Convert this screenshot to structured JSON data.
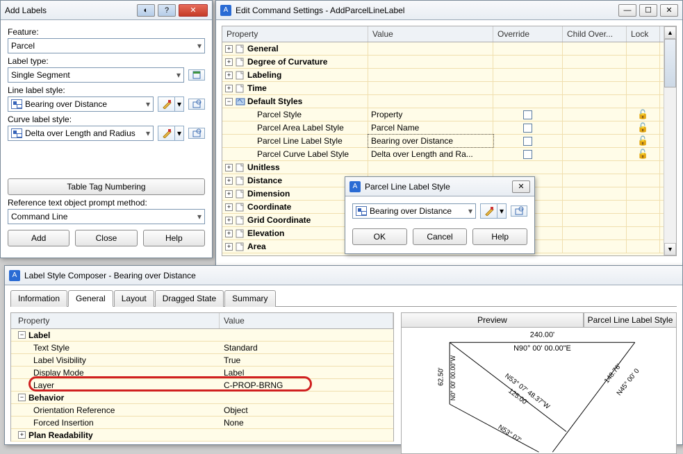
{
  "addLabels": {
    "title": "Add Labels",
    "feature_label": "Feature:",
    "feature_value": "Parcel",
    "labeltype_label": "Label type:",
    "labeltype_value": "Single Segment",
    "linelabel_label": "Line label style:",
    "linelabel_value": "Bearing over Distance",
    "curvelabel_label": "Curve label style:",
    "curvelabel_value": "Delta over Length and Radius",
    "tabletag_btn": "Table Tag Numbering",
    "refmethod_label": "Reference text object prompt method:",
    "refmethod_value": "Command Line",
    "add_btn": "Add",
    "close_btn": "Close",
    "help_btn": "Help"
  },
  "editCmd": {
    "title": "Edit Command Settings - AddParcelLineLabel",
    "headers": {
      "property": "Property",
      "value": "Value",
      "override": "Override",
      "childover": "Child Over...",
      "lock": "Lock"
    },
    "groups_top": [
      "General",
      "Degree of Curvature",
      "Labeling",
      "Time"
    ],
    "default_styles_label": "Default Styles",
    "default_styles": [
      {
        "name": "Parcel Style",
        "value": "Property"
      },
      {
        "name": "Parcel Area Label Style",
        "value": "Parcel Name"
      },
      {
        "name": "Parcel Line Label Style",
        "value": "Bearing over Distance",
        "sel_val": true
      },
      {
        "name": "Parcel Curve Label Style",
        "value": "Delta over Length and Ra..."
      }
    ],
    "groups_bot": [
      "Unitless",
      "Distance",
      "Dimension",
      "Coordinate",
      "Grid Coordinate",
      "Elevation",
      "Area"
    ]
  },
  "pllsDialog": {
    "title": "Parcel Line Label Style",
    "value": "Bearing over Distance",
    "ok": "OK",
    "cancel": "Cancel",
    "help": "Help"
  },
  "composer": {
    "title": "Label Style Composer - Bearing over Distance",
    "tabs": [
      "Information",
      "General",
      "Layout",
      "Dragged State",
      "Summary"
    ],
    "active_tab": "General",
    "headers": {
      "property": "Property",
      "value": "Value"
    },
    "rows": [
      {
        "type": "group",
        "label": "Label",
        "open": true
      },
      {
        "type": "kv",
        "label": "Text Style",
        "value": "Standard"
      },
      {
        "type": "kv",
        "label": "Label Visibility",
        "value": "True"
      },
      {
        "type": "kv",
        "label": "Display Mode",
        "value": "Label"
      },
      {
        "type": "kv",
        "label": "Layer",
        "value": "C-PROP-BRNG",
        "highlight": true
      },
      {
        "type": "group",
        "label": "Behavior",
        "open": true
      },
      {
        "type": "kv",
        "label": "Orientation Reference",
        "value": "Object"
      },
      {
        "type": "kv",
        "label": "Forced Insertion",
        "value": "None"
      },
      {
        "type": "group",
        "label": "Plan Readability",
        "open": false
      }
    ],
    "preview_label": "Preview",
    "preview_style_label": "Parcel Line Label Style",
    "preview_labels": {
      "top_dist": "240.00'",
      "top_brng": "N90° 00' 00.00\"E",
      "nw_brng": "N53° 07' 48.37\"W",
      "nw_dist": "125.00'",
      "w_dist": "62.50'",
      "w_brng": "N0° 00' 00.00\"W",
      "se2_brng": "N53° 07'",
      "se_dist": "148.76'",
      "se_brng2": "N45° 00' 0"
    }
  }
}
